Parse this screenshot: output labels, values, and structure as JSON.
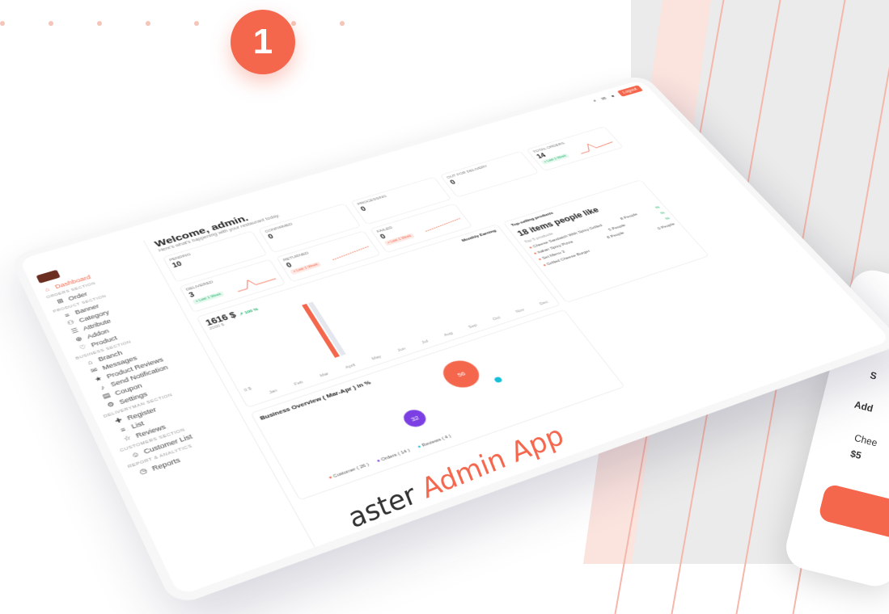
{
  "step_number": "1",
  "caption": {
    "prefix": "aster ",
    "highlight": "Admin App"
  },
  "topbar": {
    "logout_label": "Logout"
  },
  "sidebar": {
    "dashboard": "Dashboard",
    "orders_section": "ORDERS SECTION",
    "order": "Order",
    "product_section": "PRODUCT SECTION",
    "banner": "Banner",
    "category": "Category",
    "attribute": "Attribute",
    "addon": "Addon",
    "product": "Product",
    "business_section": "BUSINESS SECTION",
    "branch": "Branch",
    "messages": "Messages",
    "product_reviews": "Product Reviews",
    "send_notification": "Send Notification",
    "coupon": "Coupon",
    "settings": "Settings",
    "deliveryman_section": "DELIVERYMAN SECTION",
    "register": "Register",
    "list": "List",
    "reviews": "Reviews",
    "customers_section": "CUSTOMERS SECTION",
    "customer_list": "Customer List",
    "report_section": "REPORT & ANALYTICS",
    "reports": "Reports"
  },
  "welcome": {
    "title": "Welcome, admin.",
    "subtitle": "Here's what's happening with your restaurant today."
  },
  "stats": [
    {
      "label": "PENDING",
      "value": "10"
    },
    {
      "label": "CONFIRMED",
      "value": "0"
    },
    {
      "label": "PROCESSING",
      "value": "0"
    },
    {
      "label": "OUT FOR DELIVERY",
      "value": "0"
    },
    {
      "label": "TOTAL ORDERS",
      "value": "14",
      "tag": "+ Last 1 Week"
    },
    {
      "label": "DELIVERED",
      "value": "3",
      "tag": "+ Last 1 Week"
    },
    {
      "label": "RETURNED",
      "value": "0",
      "tag": "+ Last 1 Week"
    },
    {
      "label": "FAILED",
      "value": "0",
      "tag": "+ Last 1 Week"
    }
  ],
  "revenue": {
    "amount": "1616 $",
    "change": "↗ 100 %",
    "ytick": "2000 $",
    "y0": "0 $",
    "chart_label": "Monthly Earning",
    "months": [
      "Jan",
      "Feb",
      "Mar",
      "April",
      "May",
      "Jun",
      "Jul",
      "Aug",
      "Sep",
      "Oct",
      "Nov",
      "Dec"
    ]
  },
  "top_products": {
    "label": "Top-selling products",
    "title": "18 items people like",
    "subtitle": "Top 5 products",
    "rows": [
      {
        "name": "Cheese Sandwich With Spicy Grilled",
        "people": "8 People",
        "pct": "%"
      },
      {
        "name": "Italian Spicy Pizza",
        "people": "5 People",
        "pct": "%"
      },
      {
        "name": "Set Menu 3",
        "people": "8 People",
        "pct": "%"
      },
      {
        "name": "Grilled Cheese Burger",
        "people": "0 People",
        "pct": "%"
      }
    ]
  },
  "business": {
    "title": "Business Overview ( Mar-Apr ) in %",
    "bubbles": [
      {
        "label": "56",
        "color": "#f4674d"
      },
      {
        "label": "32",
        "color": "#7b3fe4"
      },
      {
        "label": "0",
        "color": "#14c0d8"
      }
    ],
    "legend": [
      {
        "label": "Customer ( 26 )",
        "color": "#f4674d"
      },
      {
        "label": "Orders ( 14 )",
        "color": "#7b3fe4"
      },
      {
        "label": "Reviews ( 4 )",
        "color": "#14c0d8"
      }
    ]
  },
  "phone": {
    "line1": "S",
    "line2": "Add",
    "line3": "Chee",
    "line4": "$5"
  }
}
